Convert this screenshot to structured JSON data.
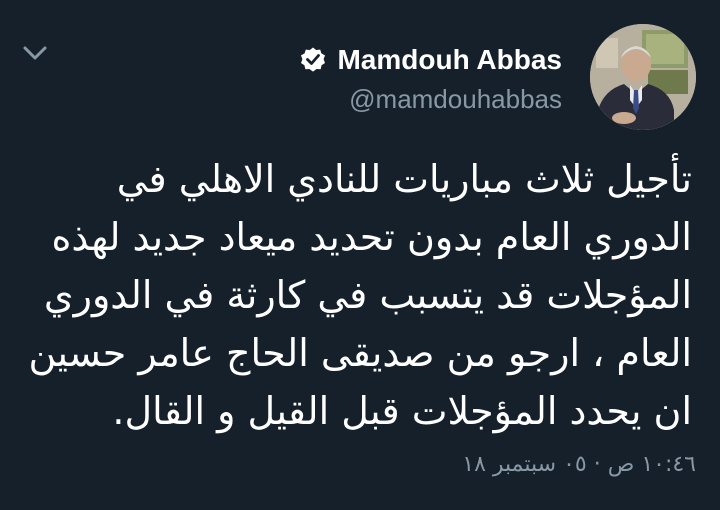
{
  "colors": {
    "background": "#15202b",
    "primary_text": "#ffffff",
    "secondary_text": "#8899a6",
    "chevron": "#8899a6"
  },
  "icons": {
    "menu": "chevron-down-icon",
    "verified": "verified-badge-icon"
  },
  "author": {
    "display_name": "Mamdouh Abbas",
    "handle": "@mamdouhabbas"
  },
  "tweet": {
    "lines": [
      "تأجيل ثلاث مباريات للنادي الاهلي في",
      "الدوري العام بدون تحديد ميعاد جديد لهذه",
      "المؤجلات قد يتسبب في كارثة في الدوري",
      "العام ، ارجو من صديقى الحاج عامر حسين",
      "ان يحدد المؤجلات قبل القيل و القال."
    ],
    "timestamp": "١٠:٤٦ ص · ٠٥ سبتمبر ١٨"
  }
}
